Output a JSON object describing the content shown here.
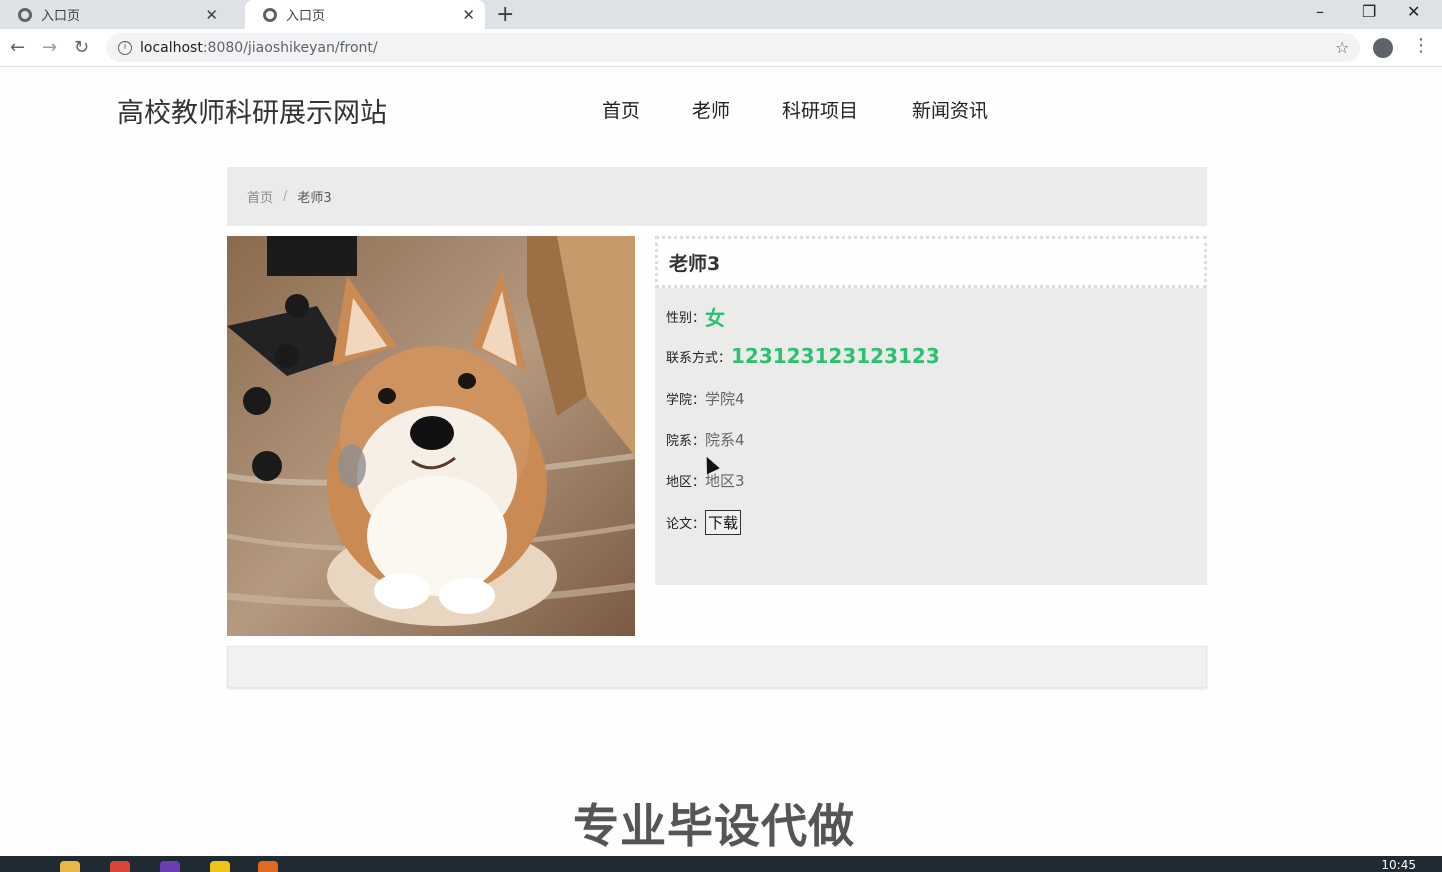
{
  "browser": {
    "tabs": [
      {
        "title": "入口页",
        "active": false
      },
      {
        "title": "入口页",
        "active": true
      }
    ],
    "new_tab": "+",
    "close_glyph": "✕",
    "url_host": "localhost",
    "url_path": ":8080/jiaoshikeyan/front/"
  },
  "site": {
    "title": "高校教师科研展示网站",
    "nav": [
      "首页",
      "老师",
      "科研项目",
      "新闻资讯"
    ]
  },
  "breadcrumb": {
    "home": "首页",
    "separator": "/",
    "current": "老师3"
  },
  "teacher": {
    "name": "老师3",
    "fields": {
      "gender_label": "性别：",
      "gender": "女",
      "contact_label": "联系方式：",
      "contact": "123123123123123",
      "college_label": "学院：",
      "college": "学院4",
      "dept_label": "院系：",
      "dept": "院系4",
      "region_label": "地区：",
      "region": "地区3",
      "paper_label": "论文：",
      "download": "下载"
    }
  },
  "watermark": "专业毕设代做",
  "taskbar": {
    "clock": "10:45"
  },
  "colors": {
    "accent_green": "#2fbf71",
    "panel_gray": "#ebebea"
  }
}
